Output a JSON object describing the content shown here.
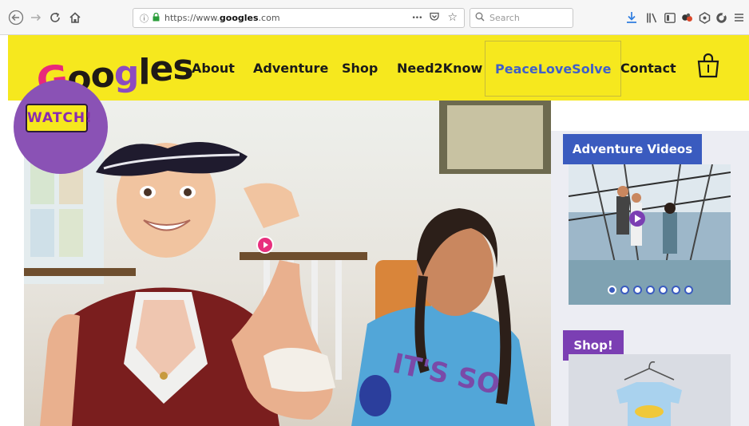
{
  "browser": {
    "url_prefix": "https://www.",
    "url_domain": "googles",
    "url_suffix": ".com",
    "search_placeholder": "Search",
    "more_glyph": "•••"
  },
  "site": {
    "logo_letters": [
      "G",
      "o",
      "o",
      "g",
      "l",
      "e",
      "s"
    ],
    "nav": [
      {
        "label": "About"
      },
      {
        "label": "Adventure"
      },
      {
        "label": "Shop"
      },
      {
        "label": "Need2Know"
      },
      {
        "label": "PeaceLoveSolve",
        "active": true
      },
      {
        "label": "Contact"
      }
    ],
    "colors": {
      "header_yellow": "#f6e81e",
      "active_nav": "#3f5fc9",
      "adventure_blue": "#3a5bbf",
      "shop_purple": "#7b3fb3",
      "play_pink": "#e82f7d"
    }
  },
  "hero": {
    "badge_text": "WATCH!"
  },
  "sidebar": {
    "adventure_title": "Adventure Videos",
    "carousel_total": 7,
    "carousel_active_index": 1,
    "shop_title": "Shop!"
  }
}
